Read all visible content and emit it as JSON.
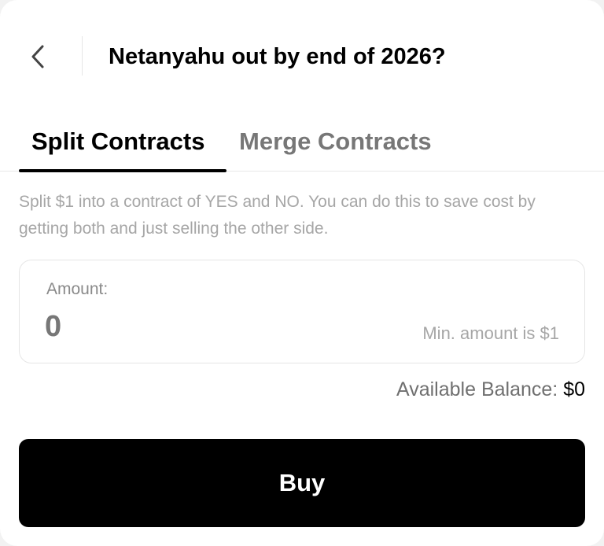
{
  "header": {
    "back_icon": "chevron-left-icon",
    "title": "Netanyahu out by end of 2026?"
  },
  "tabs": [
    {
      "label": "Split Contracts",
      "active": true
    },
    {
      "label": "Merge Contracts",
      "active": false
    }
  ],
  "description": "Split $1 into a contract of YES and NO. You can do this to save cost by getting both and just selling the other side.",
  "amount": {
    "label": "Amount:",
    "value": "0",
    "hint": "Min. amount is $1"
  },
  "balance": {
    "label": "Available Balance: ",
    "value": "$0"
  },
  "buy_button": {
    "label": "Buy"
  },
  "colors": {
    "primary": "#000000",
    "inactive_tab": "#777777",
    "muted_text": "#a6a6a6",
    "border": "#e6e6e6",
    "background": "#ffffff"
  }
}
